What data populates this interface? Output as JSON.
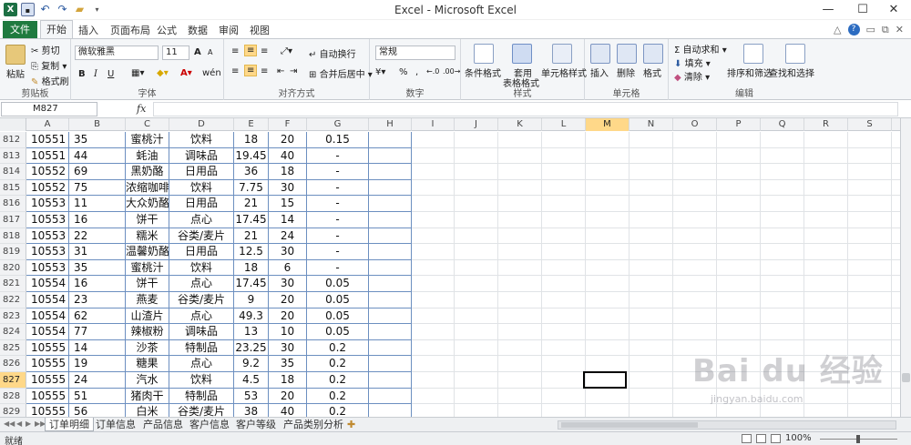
{
  "window": {
    "title": "Excel - Microsoft Excel"
  },
  "ribbon_tabs": [
    "文件",
    "开始",
    "插入",
    "页面布局",
    "公式",
    "数据",
    "审阅",
    "视图"
  ],
  "clipboard": {
    "paste": "粘贴",
    "cut": "剪切",
    "copy": "复制",
    "format_painter": "格式刷",
    "label": "剪贴板"
  },
  "font": {
    "name": "微软雅黑",
    "size": "11",
    "bold": "B",
    "italic": "I",
    "underline": "U",
    "grow": "A",
    "shrink": "A",
    "label": "字体",
    "wen": "wén"
  },
  "alignment": {
    "wrap": "自动换行",
    "merge": "合并后居中",
    "label": "对齐方式"
  },
  "number": {
    "format": "常规",
    "percent": "%",
    "comma": ",",
    "label": "数字"
  },
  "styles": {
    "conditional": "条件格式",
    "table": "套用",
    "table2": "表格格式",
    "cell_styles": "单元格样式",
    "label": "样式"
  },
  "cells": {
    "insert": "插入",
    "delete": "删除",
    "format": "格式",
    "label": "单元格"
  },
  "editing": {
    "autosum": "自动求和",
    "fill": "填充",
    "clear": "清除",
    "sort": "排序和筛选",
    "find": "查找和选择",
    "label": "编辑"
  },
  "name_box": "M827",
  "fx": "fx",
  "columns": [
    "A",
    "B",
    "C",
    "D",
    "E",
    "F",
    "G",
    "H",
    "I",
    "J",
    "K",
    "L",
    "M",
    "N",
    "O",
    "P",
    "Q",
    "R",
    "S"
  ],
  "active_column": "M",
  "active_row": "827",
  "rows": [
    {
      "row": "812",
      "a": "10551",
      "b": "35",
      "c": "蜜桃汁",
      "d": "饮料",
      "e": "18",
      "f": "20",
      "g": "0.15"
    },
    {
      "row": "813",
      "a": "10551",
      "b": "44",
      "c": "蚝油",
      "d": "调味品",
      "e": "19.45",
      "f": "40",
      "g": "-"
    },
    {
      "row": "814",
      "a": "10552",
      "b": "69",
      "c": "黑奶酪",
      "d": "日用品",
      "e": "36",
      "f": "18",
      "g": "-"
    },
    {
      "row": "815",
      "a": "10552",
      "b": "75",
      "c": "浓缩咖啡",
      "d": "饮料",
      "e": "7.75",
      "f": "30",
      "g": "-"
    },
    {
      "row": "816",
      "a": "10553",
      "b": "11",
      "c": "大众奶酪",
      "d": "日用品",
      "e": "21",
      "f": "15",
      "g": "-"
    },
    {
      "row": "817",
      "a": "10553",
      "b": "16",
      "c": "饼干",
      "d": "点心",
      "e": "17.45",
      "f": "14",
      "g": "-"
    },
    {
      "row": "818",
      "a": "10553",
      "b": "22",
      "c": "糯米",
      "d": "谷类/麦片",
      "e": "21",
      "f": "24",
      "g": "-"
    },
    {
      "row": "819",
      "a": "10553",
      "b": "31",
      "c": "温馨奶酪",
      "d": "日用品",
      "e": "12.5",
      "f": "30",
      "g": "-"
    },
    {
      "row": "820",
      "a": "10553",
      "b": "35",
      "c": "蜜桃汁",
      "d": "饮料",
      "e": "18",
      "f": "6",
      "g": "-"
    },
    {
      "row": "821",
      "a": "10554",
      "b": "16",
      "c": "饼干",
      "d": "点心",
      "e": "17.45",
      "f": "30",
      "g": "0.05"
    },
    {
      "row": "822",
      "a": "10554",
      "b": "23",
      "c": "燕麦",
      "d": "谷类/麦片",
      "e": "9",
      "f": "20",
      "g": "0.05"
    },
    {
      "row": "823",
      "a": "10554",
      "b": "62",
      "c": "山渣片",
      "d": "点心",
      "e": "49.3",
      "f": "20",
      "g": "0.05"
    },
    {
      "row": "824",
      "a": "10554",
      "b": "77",
      "c": "辣椒粉",
      "d": "调味品",
      "e": "13",
      "f": "10",
      "g": "0.05"
    },
    {
      "row": "825",
      "a": "10555",
      "b": "14",
      "c": "沙茶",
      "d": "特制品",
      "e": "23.25",
      "f": "30",
      "g": "0.2"
    },
    {
      "row": "826",
      "a": "10555",
      "b": "19",
      "c": "糖果",
      "d": "点心",
      "e": "9.2",
      "f": "35",
      "g": "0.2"
    },
    {
      "row": "827",
      "a": "10555",
      "b": "24",
      "c": "汽水",
      "d": "饮料",
      "e": "4.5",
      "f": "18",
      "g": "0.2"
    },
    {
      "row": "828",
      "a": "10555",
      "b": "51",
      "c": "猪肉干",
      "d": "特制品",
      "e": "53",
      "f": "20",
      "g": "0.2"
    },
    {
      "row": "829",
      "a": "10555",
      "b": "56",
      "c": "白米",
      "d": "谷类/麦片",
      "e": "38",
      "f": "40",
      "g": "0.2"
    }
  ],
  "sheet_tabs": [
    "订单明细",
    "订单信息",
    "产品信息",
    "客户信息",
    "客户等级",
    "产品类别分析"
  ],
  "status": {
    "text": "就绪",
    "zoom": "100%"
  },
  "watermark": {
    "brand": "Bai du 经验",
    "url": "jingyan.baidu.com"
  },
  "colors": {
    "excel_green": "#1f7a3f",
    "active_header": "#ffd889",
    "data_border": "#6c8fc0"
  }
}
